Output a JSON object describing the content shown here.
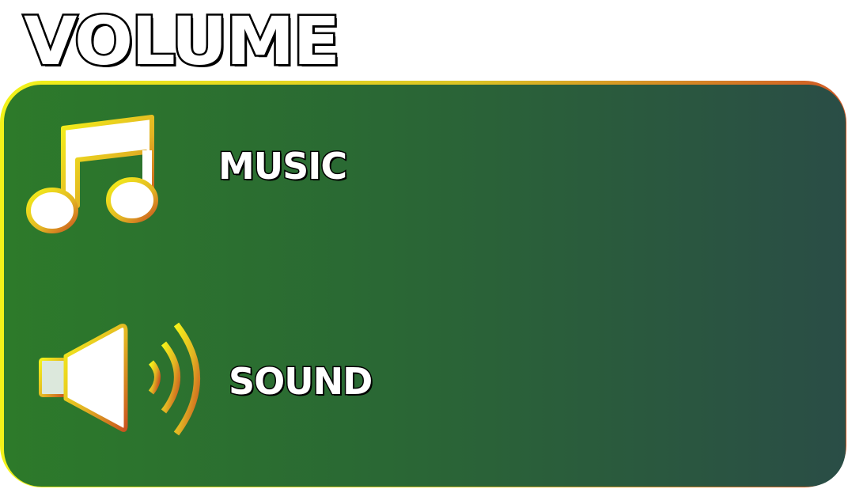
{
  "title": "VOLUME",
  "settings": [
    {
      "label": "MUSIC",
      "icon": "music-note-icon"
    },
    {
      "label": "SOUND",
      "icon": "speaker-icon"
    }
  ],
  "colors": {
    "panel_gradient_start": "#2d7a2a",
    "panel_gradient_end": "#2a4d46",
    "border_start": "#f2f21a",
    "border_end": "#d15a25",
    "icon_fill": "#ffffff",
    "icon_outline": "#e8d81a"
  }
}
